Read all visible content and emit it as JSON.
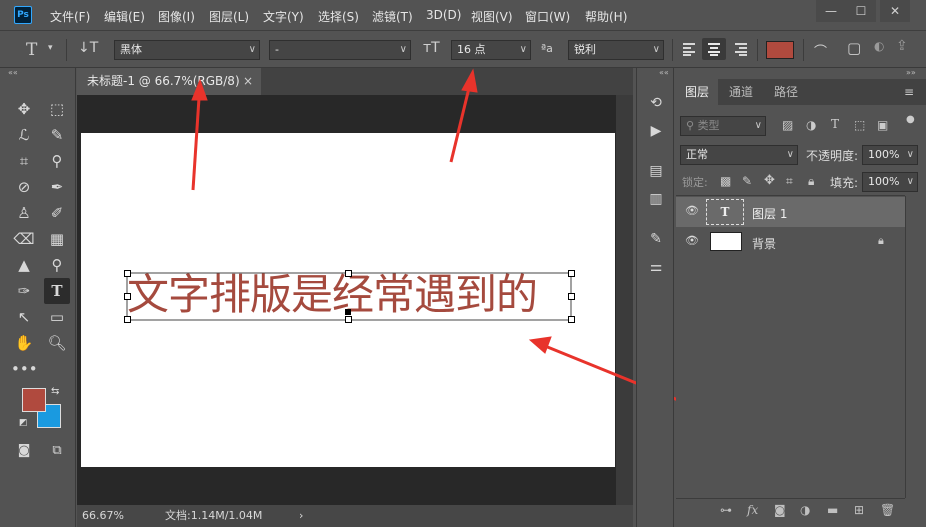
{
  "app": {
    "logo": "Ps"
  },
  "menu": [
    "文件(F)",
    "编辑(E)",
    "图像(I)",
    "图层(L)",
    "文字(Y)",
    "选择(S)",
    "滤镜(T)",
    "3D(D)",
    "视图(V)",
    "窗口(W)",
    "帮助(H)"
  ],
  "window_controls": {
    "minimize": "—",
    "maximize": "☐",
    "close": "✕"
  },
  "options": {
    "font_family": "黑体",
    "font_style": "-",
    "font_size": "16 点",
    "antialias": "锐利",
    "text_color": "#b04a3e"
  },
  "document": {
    "tab_title": "未标题-1 @ 66.7%(RGB/8)",
    "tab_close": "×",
    "text": "文字排版是经常遇到的",
    "text_color": "#a54a3e"
  },
  "status": {
    "zoom": "66.67%",
    "doc_info": "文档:1.14M/1.04M",
    "arrow": "›"
  },
  "colors": {
    "foreground": "#b04a3e",
    "background": "#1a9ae0"
  },
  "layers_panel": {
    "tabs": [
      "图层",
      "通道",
      "路径"
    ],
    "filter_label": "类型",
    "blend_mode": "正常",
    "opacity_label": "不透明度:",
    "opacity_value": "100%",
    "lock_label": "锁定:",
    "fill_label": "填充:",
    "fill_value": "100%",
    "layers": [
      {
        "name": "图层 1",
        "type": "text",
        "thumb": "T"
      },
      {
        "name": "背景",
        "type": "background"
      }
    ]
  }
}
